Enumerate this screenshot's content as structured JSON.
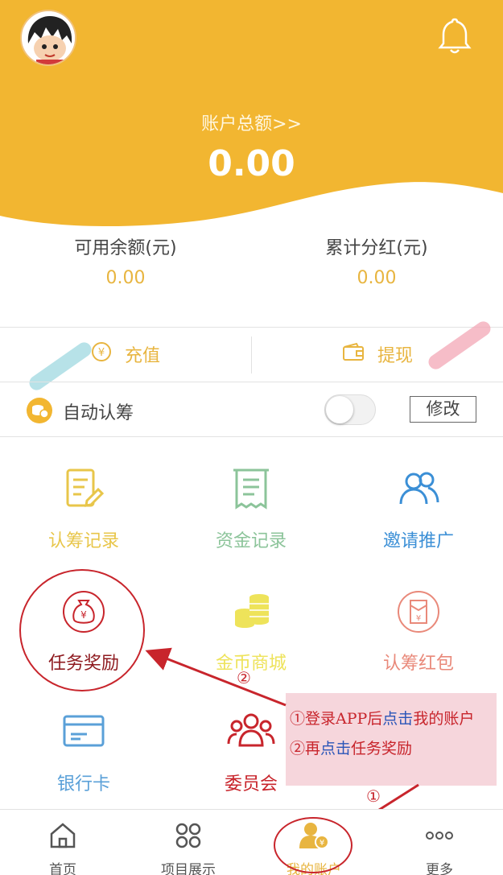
{
  "header": {
    "total_label": "账户总额>>",
    "total_value": "0.00",
    "colors": {
      "brand": "#f2b631",
      "accent": "#e8b540"
    }
  },
  "balances": {
    "available_label": "可用余额(元)",
    "available_value": "0.00",
    "dividend_label": "累计分红(元)",
    "dividend_value": "0.00"
  },
  "actions": {
    "recharge_label": "充值",
    "withdraw_label": "提现"
  },
  "auto_subscribe": {
    "label": "自动认筹",
    "toggle_on": false,
    "modify_label": "修改"
  },
  "grid": [
    {
      "label": "认筹记录",
      "icon": "document-edit-icon",
      "color": "#e8c64a"
    },
    {
      "label": "资金记录",
      "icon": "receipt-icon",
      "color": "#8cc49a"
    },
    {
      "label": "邀请推广",
      "icon": "users-icon",
      "color": "#3b8fd6"
    },
    {
      "label": "任务奖励",
      "icon": "money-bag-icon",
      "color": "#c8252c"
    },
    {
      "label": "金币商城",
      "icon": "coins-icon",
      "color": "#eee35a"
    },
    {
      "label": "认筹红包",
      "icon": "red-envelope-icon",
      "color": "#e9897a"
    },
    {
      "label": "银行卡",
      "icon": "bank-card-icon",
      "color": "#5aa0d8"
    },
    {
      "label": "委员会",
      "icon": "committee-icon",
      "color": "#c8252c"
    }
  ],
  "annotation": {
    "mark_1": "①",
    "mark_2": "②",
    "line1_a": "①登录APP后",
    "line1_b": "点击",
    "line1_c": "我的账户",
    "line2_a": "②再",
    "line2_b": "点击",
    "line2_c": "任务奖励"
  },
  "tabbar": [
    {
      "label": "首页",
      "icon": "home-icon"
    },
    {
      "label": "项目展示",
      "icon": "grid-icon"
    },
    {
      "label": "我的账户",
      "icon": "account-icon",
      "active": true
    },
    {
      "label": "更多",
      "icon": "more-icon"
    }
  ]
}
